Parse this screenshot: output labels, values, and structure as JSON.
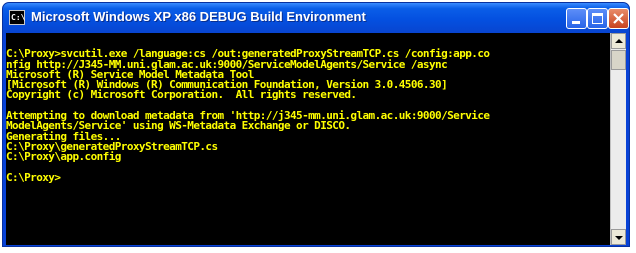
{
  "window": {
    "title": "Microsoft Windows XP x86 DEBUG Build Environment",
    "icon_label": "C:\\",
    "controls": {
      "minimize": "minimize-icon",
      "maximize": "maximize-icon",
      "close": "close-icon"
    }
  },
  "console": {
    "lines": [
      "",
      "C:\\Proxy>svcutil.exe /language:cs /out:generatedProxyStreamTCP.cs /config:app.co",
      "nfig http://J345-MM.uni.glam.ac.uk:9000/ServiceModelAgents/Service /async",
      "Microsoft (R) Service Model Metadata Tool",
      "[Microsoft (R) Windows (R) Communication Foundation, Version 3.0.4506.30]",
      "Copyright (c) Microsoft Corporation.  All rights reserved.",
      "",
      "Attempting to download metadata from 'http://j345-mm.uni.glam.ac.uk:9000/Service",
      "ModelAgents/Service' using WS-Metadata Exchange or DISCO.",
      "Generating files...",
      "C:\\Proxy\\generatedProxyStreamTCP.cs",
      "C:\\Proxy\\app.config",
      "",
      "C:\\Proxy>",
      "",
      "",
      "",
      ""
    ],
    "text_color": "#c0c0c0",
    "highlight_color": "#ffff00",
    "background": "#000000"
  },
  "scrollbar": {
    "up": "scroll-up-arrow-icon",
    "down": "scroll-down-arrow-icon"
  }
}
